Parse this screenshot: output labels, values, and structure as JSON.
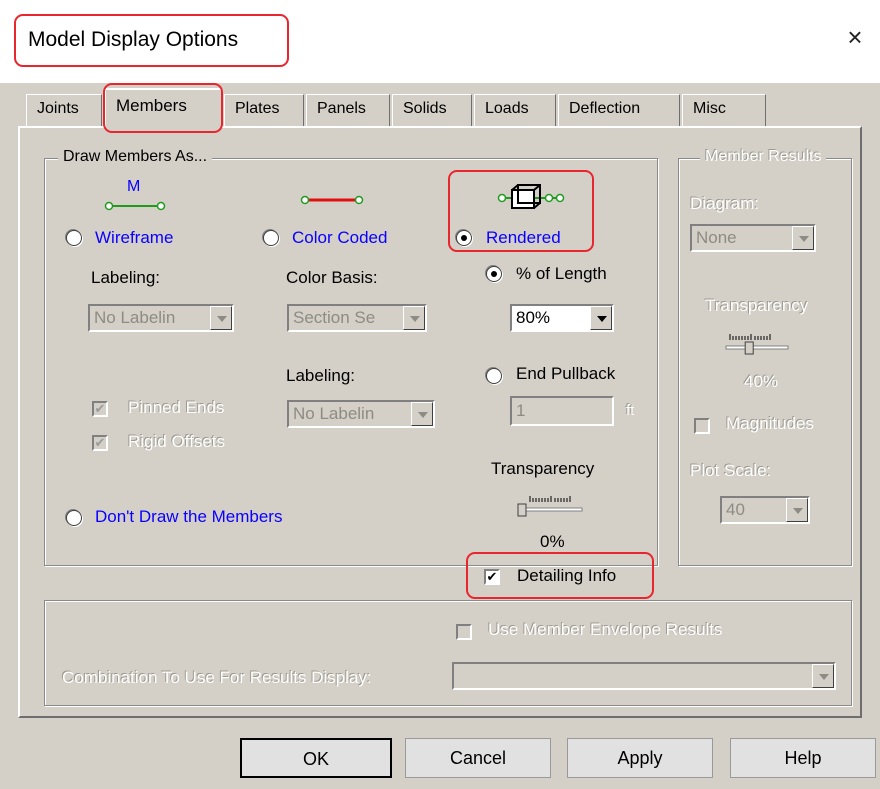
{
  "window": {
    "title": "Model Display Options",
    "close_label": "×"
  },
  "tabs": [
    {
      "label": "Joints"
    },
    {
      "label": "Members"
    },
    {
      "label": "Plates"
    },
    {
      "label": "Panels"
    },
    {
      "label": "Solids"
    },
    {
      "label": "Loads"
    },
    {
      "label": "Deflection"
    },
    {
      "label": "Misc"
    }
  ],
  "draw_members": {
    "legend": "Draw Members As...",
    "wireframe": {
      "label": "Wireframe",
      "icon_text": "M",
      "selected": false
    },
    "color_coded": {
      "label": "Color Coded",
      "selected": false
    },
    "rendered": {
      "label": "Rendered",
      "selected": true
    },
    "wire_labeling": {
      "label": "Labeling:",
      "value": "No Labelin"
    },
    "color_basis": {
      "label": "Color Basis:",
      "value": "Section Se"
    },
    "color_labeling": {
      "label": "Labeling:",
      "value": "No Labelin"
    },
    "pinned_ends": {
      "label": "Pinned Ends",
      "checked": true
    },
    "rigid_offsets": {
      "label": "Rigid Offsets",
      "checked": true
    },
    "pct_length": {
      "label": "% of Length",
      "value": "80%",
      "selected": true
    },
    "end_pullback": {
      "label": "End Pullback",
      "value": "1",
      "unit": "ft",
      "selected": false
    },
    "transparency": {
      "label": "Transparency",
      "value_label": "0%",
      "value": 0
    },
    "dont_draw": {
      "label": "Don't Draw the Members",
      "selected": false
    },
    "detailing_info": {
      "label": "Detailing Info",
      "checked": true
    }
  },
  "member_results": {
    "legend": "Member Results",
    "diagram_label": "Diagram:",
    "diagram_value": "None",
    "transparency_label": "Transparency",
    "transparency_value_label": "40%",
    "transparency_value": 40,
    "magnitudes_label": "Magnitudes",
    "plot_scale_label": "Plot Scale:",
    "plot_scale_value": "40"
  },
  "envelope": {
    "use_envelope_label": "Use Member Envelope Results",
    "combination_label": "Combination To Use For Results Display:",
    "combination_value": ""
  },
  "buttons": {
    "ok": "OK",
    "cancel": "Cancel",
    "apply": "Apply",
    "help": "Help"
  },
  "colors": {
    "highlight": "#e8262e",
    "dialog_bg": "#d4d0c8",
    "link_blue": "#0a00ff",
    "icon_green": "#1e9c1e",
    "icon_red": "#e01010"
  }
}
